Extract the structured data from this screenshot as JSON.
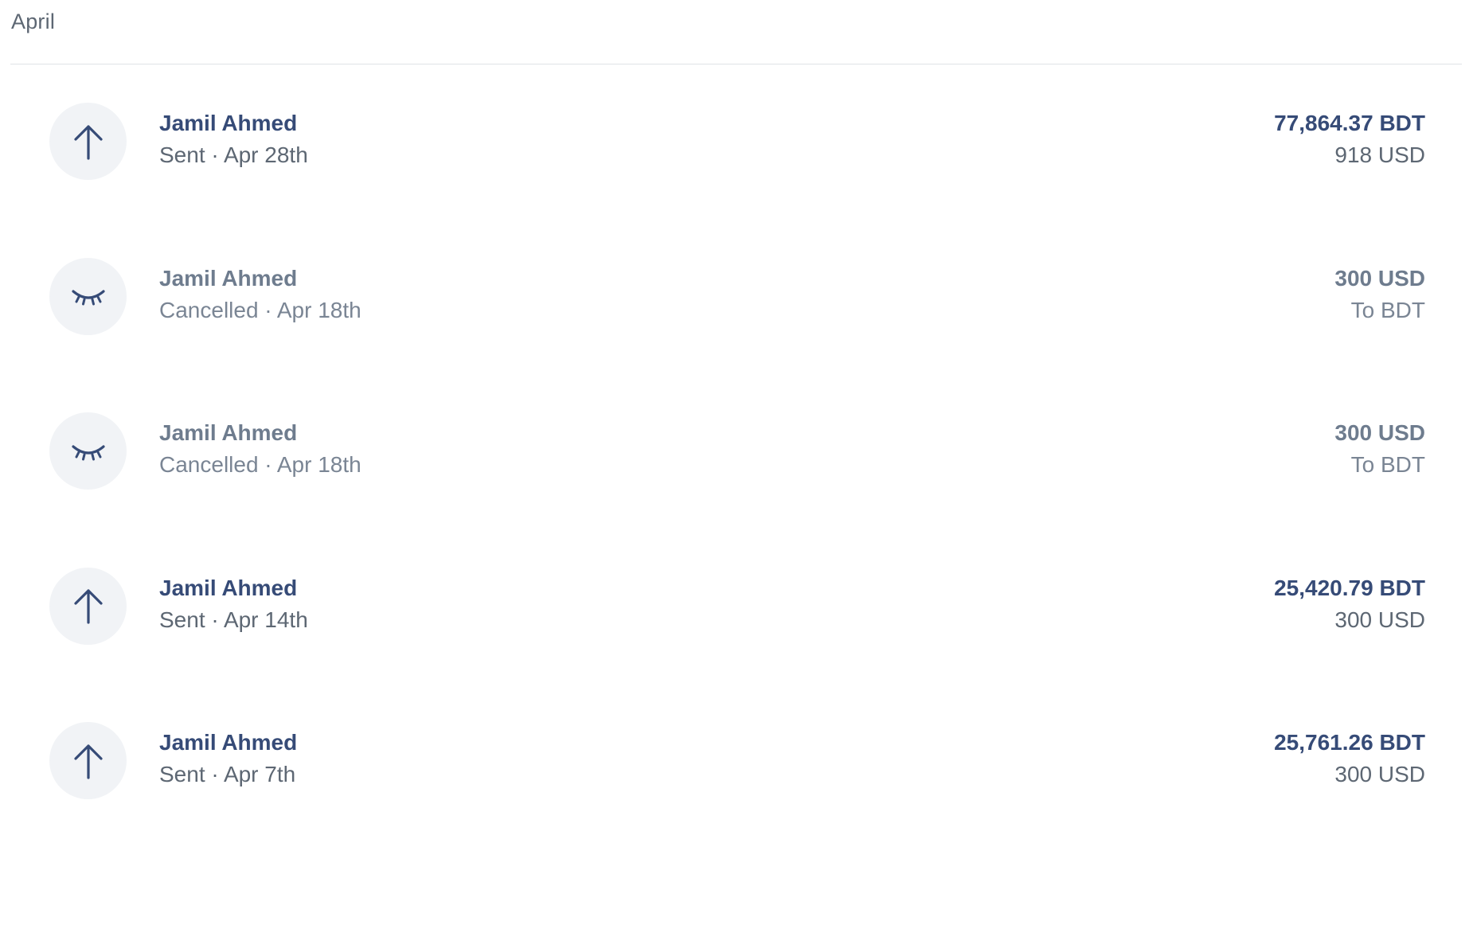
{
  "section": {
    "month_label": "April"
  },
  "transactions": [
    {
      "name": "Jamil Ahmed",
      "status": "Sent",
      "date": "Apr 28th",
      "subtitle": "Sent · Apr 28th",
      "amount": "77,864.37 BDT",
      "secondary": "918 USD",
      "icon": "arrow-up-icon"
    },
    {
      "name": "Jamil Ahmed",
      "status": "Cancelled",
      "date": "Apr 18th",
      "subtitle": "Cancelled · Apr 18th",
      "amount": "300 USD",
      "secondary": "To BDT",
      "icon": "closed-eye-icon"
    },
    {
      "name": "Jamil Ahmed",
      "status": "Cancelled",
      "date": "Apr 18th",
      "subtitle": "Cancelled · Apr 18th",
      "amount": "300 USD",
      "secondary": "To BDT",
      "icon": "closed-eye-icon"
    },
    {
      "name": "Jamil Ahmed",
      "status": "Sent",
      "date": "Apr 14th",
      "subtitle": "Sent · Apr 14th",
      "amount": "25,420.79 BDT",
      "secondary": "300 USD",
      "icon": "arrow-up-icon"
    },
    {
      "name": "Jamil Ahmed",
      "status": "Sent",
      "date": "Apr 7th",
      "subtitle": "Sent · Apr 7th",
      "amount": "25,761.26 BDT",
      "secondary": "300 USD",
      "icon": "arrow-up-icon"
    }
  ],
  "colors": {
    "primary_text": "#364b77",
    "secondary_text": "#5d6773",
    "muted_text": "#6e7c8e",
    "icon_bg": "#f1f3f6",
    "divider": "#dfe2e7"
  }
}
